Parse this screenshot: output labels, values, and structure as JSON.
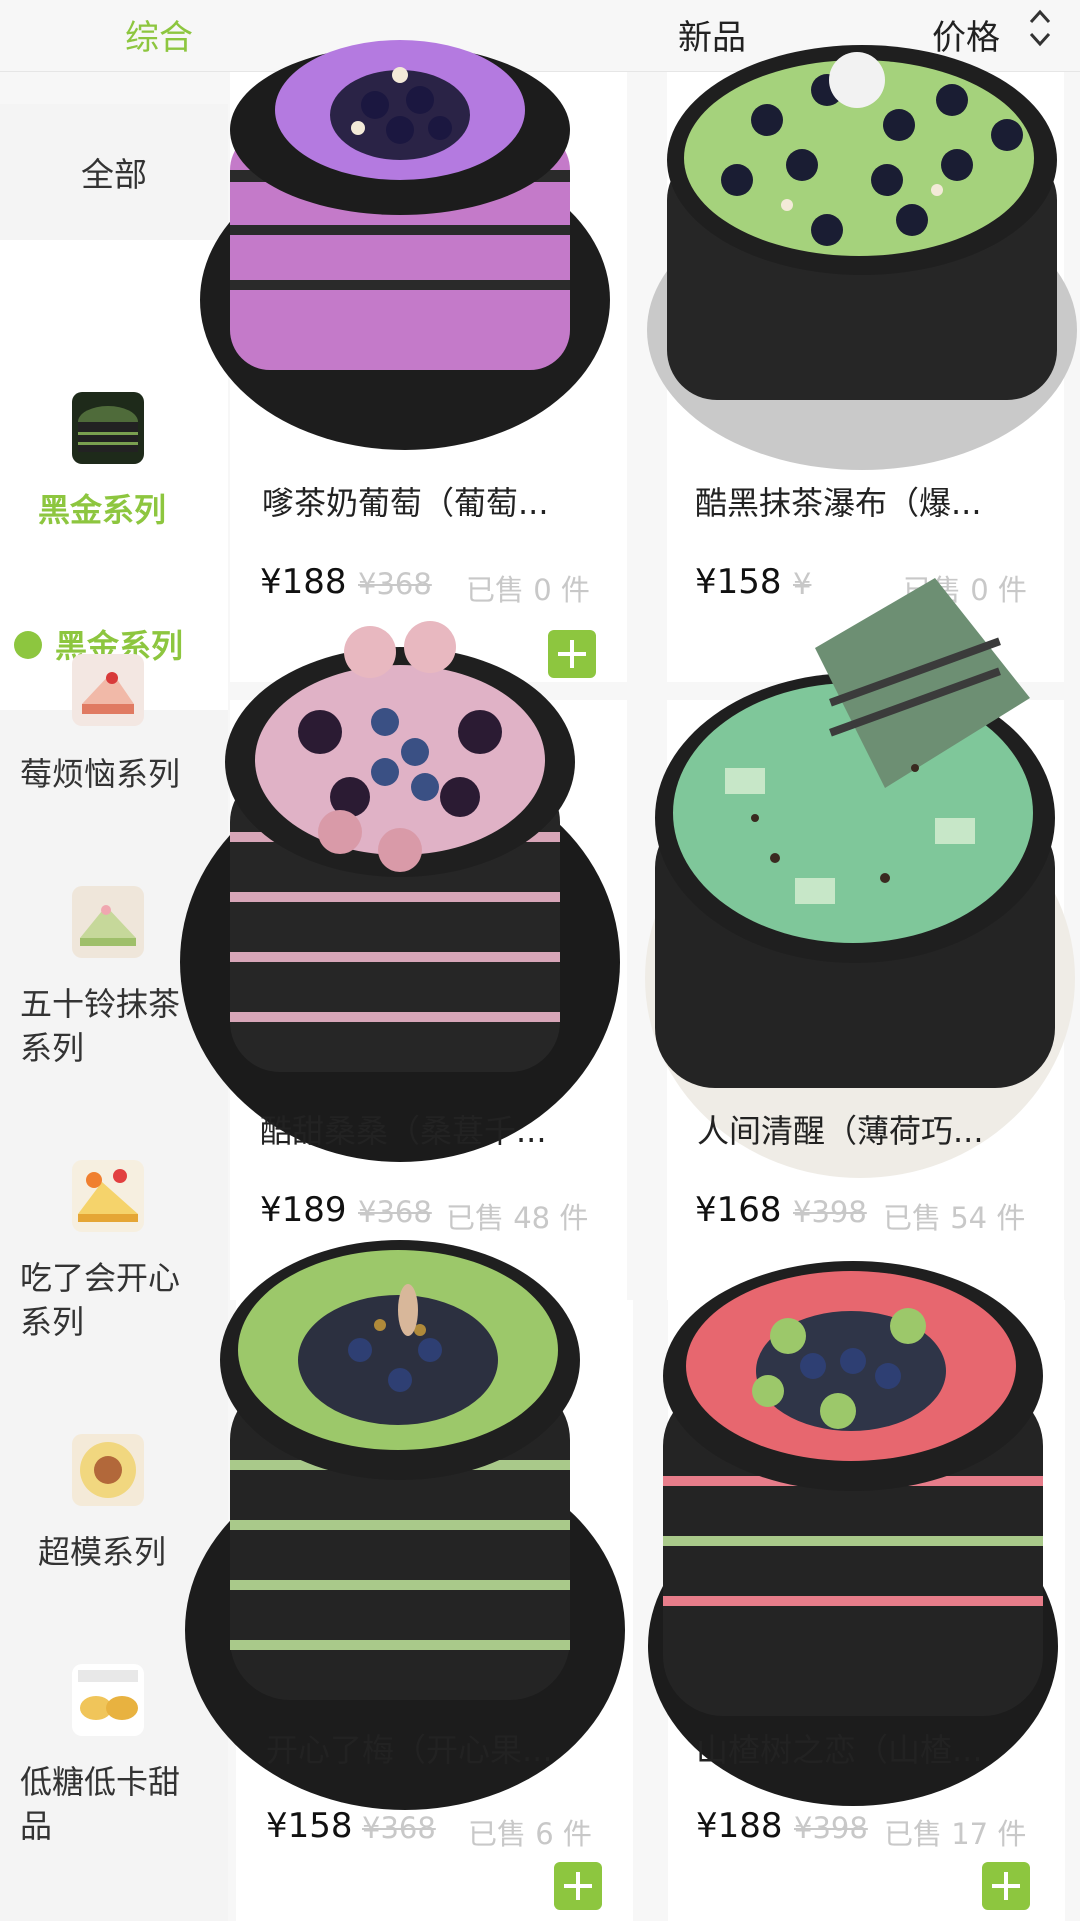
{
  "sort_bar": {
    "zonghe": "综合",
    "new": "新品",
    "price": "价格"
  },
  "sidebar": {
    "all": "全部",
    "active_category": "黑金系列",
    "active_sub": "黑金系列",
    "items": [
      {
        "label": "莓烦恼系列"
      },
      {
        "label1": "五十铃抹茶",
        "label2": "系列"
      },
      {
        "label1": "吃了会开心",
        "label2": "系列"
      },
      {
        "label": "超模系列"
      },
      {
        "label1": "低糖低卡甜",
        "label2": "品"
      }
    ]
  },
  "products": [
    {
      "name": "嗲茶奶葡萄（葡萄...",
      "price": "¥188",
      "orig": "¥368",
      "sold": "已售 0 件"
    },
    {
      "name": "酷黑抹茶瀑布（爆...",
      "price": "¥158",
      "orig": "¥",
      "sold": "已售 0 件"
    },
    {
      "name": "酷甜桑桑（桑葚千...",
      "price": "¥189",
      "orig": "¥368",
      "sold": "已售 48 件"
    },
    {
      "name": "人间清醒（薄荷巧...",
      "price": "¥168",
      "orig": "¥398",
      "sold": "已售 54 件"
    },
    {
      "name": "开心了梅（开心果...",
      "price": "¥158",
      "orig": "¥368",
      "sold": "已售 6 件"
    },
    {
      "name": "山楂树之恋（山楂...",
      "price": "¥188",
      "orig": "¥398",
      "sold": "已售 17 件"
    }
  ],
  "colors": {
    "accent": "#8dc63f",
    "muted": "#c8c8c8"
  }
}
